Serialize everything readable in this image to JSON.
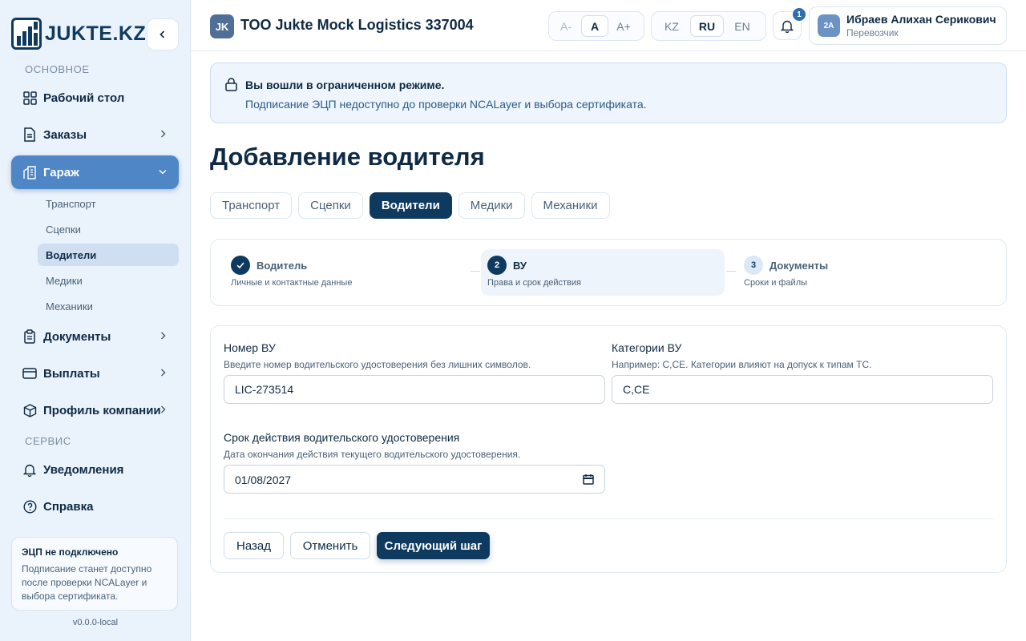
{
  "sidebar": {
    "logo_text": "JUKTE.KZ",
    "section_main": "ОСНОВНОЕ",
    "section_service": "СЕРВИС",
    "items": {
      "dashboard": "Рабочий стол",
      "orders": "Заказы",
      "garage": "Гараж",
      "documents": "Документы",
      "payouts": "Выплаты",
      "company": "Профиль компании",
      "notifications": "Уведомления",
      "help": "Справка"
    },
    "garage_sub": {
      "transport": "Транспорт",
      "trailers": "Сцепки",
      "drivers": "Водители",
      "medics": "Медики",
      "mechanics": "Механики"
    },
    "ecp": {
      "title": "ЭЦП не подключено",
      "text": "Подписание станет доступно после проверки NCALayer и выбора сертификата."
    },
    "version": "v0.0.0-local"
  },
  "header": {
    "company_badge": "JK",
    "company_name": "ТОО Jukte Mock Logistics 337004",
    "font_size": {
      "minus": "A-",
      "normal": "A",
      "plus": "A+"
    },
    "lang": {
      "kz": "KZ",
      "ru": "RU",
      "en": "EN"
    },
    "notifications_count": "1",
    "user": {
      "initials": "2A",
      "name": "Ибраев Алихан Серикович",
      "role": "Перевозчик"
    }
  },
  "alert": {
    "title": "Вы вошли в ограниченном режиме.",
    "text": "Подписание ЭЦП недоступно до проверки NCALayer и выбора сертификата."
  },
  "page": {
    "title": "Добавление водителя",
    "tabs": {
      "transport": "Транспорт",
      "trailers": "Сцепки",
      "drivers": "Водители",
      "medics": "Медики",
      "mechanics": "Механики"
    }
  },
  "stepper": {
    "step1": {
      "title": "Водитель",
      "sub": "Личные и контактные данные"
    },
    "step2": {
      "num": "2",
      "title": "ВУ",
      "sub": "Права и срок действия"
    },
    "step3": {
      "num": "3",
      "title": "Документы",
      "sub": "Сроки и файлы"
    }
  },
  "form": {
    "license_number": {
      "label": "Номер ВУ",
      "hint": "Введите номер водительского удостоверения без лишних символов.",
      "value": "LIC-273514"
    },
    "categories": {
      "label": "Категории ВУ",
      "hint": "Например: C,CE. Категории влияют на допуск к типам ТС.",
      "value": "C,CE"
    },
    "expiry": {
      "label": "Срок действия водительского удостоверения",
      "hint": "Дата окончания действия текущего водительского удостоверения.",
      "value": "01/08/2027"
    },
    "buttons": {
      "back": "Назад",
      "cancel": "Отменить",
      "next": "Следующий шаг"
    }
  },
  "colors": {
    "primary": "#0f3a5f",
    "accent": "#4f86c6",
    "sidebar_bg": "#eaf2fb"
  }
}
